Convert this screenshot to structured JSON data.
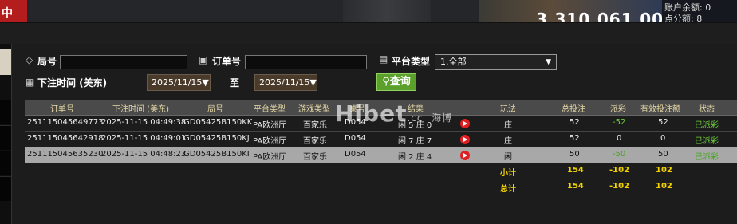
{
  "topbar": {
    "title_char": "中",
    "balance": "3,310,061.00",
    "acct_label_1": "账户余额: 0",
    "acct_label_2": "点分额: 8"
  },
  "filters": {
    "round_label": "局号",
    "round_value": "",
    "order_label": "订单号",
    "order_value": "",
    "platform_label": "平台类型",
    "platform_value": "1.全部",
    "time_label": "下注时间 (美东)",
    "date_from": "2025/11/15",
    "to_label": "至",
    "date_to": "2025/11/15",
    "query_label": "查询"
  },
  "watermark": {
    "text": "Hibet",
    "cc": ".cc",
    "cn": "海博"
  },
  "table": {
    "headers": {
      "order": "订单号",
      "time": "下注时间 (美东)",
      "round": "局号",
      "platform": "平台类型",
      "game": "游戏类型",
      "table": "桌号",
      "result": "结果",
      "bet_type": "玩法",
      "total_bet": "总投注",
      "payout": "派彩",
      "valid_bet": "有效投注额",
      "status": "状态"
    },
    "rows": [
      {
        "order": "251115045649773",
        "time": "2025-11-15 04:49:38",
        "round": "GD05425B150KK",
        "platform": "PA欧洲厅",
        "game": "百家乐",
        "table": "D054",
        "result": "闲 5 庄 0",
        "bet_type": "庄",
        "total_bet": "52",
        "payout": "-52",
        "valid_bet": "52",
        "status": "已派彩"
      },
      {
        "order": "251115045642918",
        "time": "2025-11-15 04:49:01",
        "round": "GD05425B150KJ",
        "platform": "PA欧洲厅",
        "game": "百家乐",
        "table": "D054",
        "result": "闲 7 庄 7",
        "bet_type": "庄",
        "total_bet": "52",
        "payout": "0",
        "valid_bet": "0",
        "status": "已派彩"
      },
      {
        "order": "251115045635230",
        "time": "2025-11-15 04:48:23",
        "round": "GD05425B150KI",
        "platform": "PA欧洲厅",
        "game": "百家乐",
        "table": "D054",
        "result": "闲 2 庄 4",
        "bet_type": "闲",
        "total_bet": "50",
        "payout": "-50",
        "valid_bet": "50",
        "status": "已派彩"
      }
    ],
    "subtotal": {
      "label": "小计",
      "total_bet": "154",
      "payout": "-102",
      "valid_bet": "102"
    },
    "total": {
      "label": "总计",
      "total_bet": "154",
      "payout": "-102",
      "valid_bet": "102"
    }
  },
  "colors": {
    "accent_green": "#5aa02a",
    "payout_green": "#6ed03a",
    "summary_yellow": "#f2d200"
  }
}
